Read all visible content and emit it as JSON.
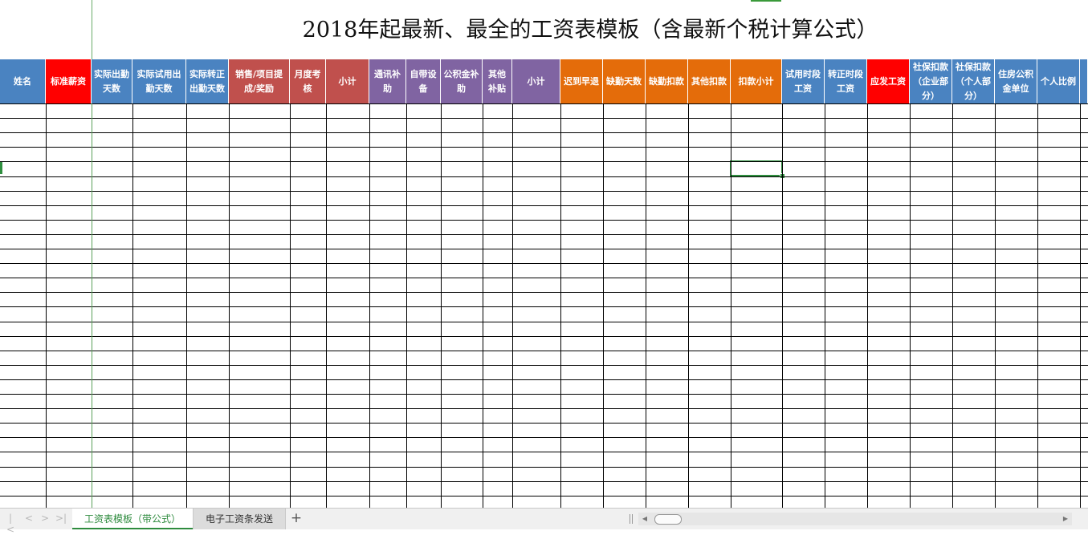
{
  "title": "2018年起最新、最全的工资表模板（含最新个税计算公式）",
  "headers": [
    {
      "label": "姓名",
      "color": "#4a83c1"
    },
    {
      "label": "标准薪资",
      "color": "#ff0000"
    },
    {
      "label": "实际出勤天数",
      "color": "#4a83c1"
    },
    {
      "label": "实际试用出勤天数",
      "color": "#4a83c1"
    },
    {
      "label": "实际转正出勤天数",
      "color": "#4a83c1"
    },
    {
      "label": "销售/项目提成/奖励",
      "color": "#c0504d"
    },
    {
      "label": "月度考核",
      "color": "#c0504d"
    },
    {
      "label": "小计",
      "color": "#c0504d"
    },
    {
      "label": "通讯补助",
      "color": "#8064a2"
    },
    {
      "label": "自带设备",
      "color": "#8064a2"
    },
    {
      "label": "公积金补助",
      "color": "#8064a2"
    },
    {
      "label": "其他补贴",
      "color": "#8064a2"
    },
    {
      "label": "小计",
      "color": "#8064a2"
    },
    {
      "label": "迟到早退",
      "color": "#e46c0a"
    },
    {
      "label": "缺勤天数",
      "color": "#e46c0a"
    },
    {
      "label": "缺勤扣款",
      "color": "#e46c0a"
    },
    {
      "label": "其他扣款",
      "color": "#e46c0a"
    },
    {
      "label": "扣款小计",
      "color": "#e46c0a"
    },
    {
      "label": "试用时段工资",
      "color": "#4a83c1"
    },
    {
      "label": "转正时段工资",
      "color": "#4a83c1"
    },
    {
      "label": "应发工资",
      "color": "#ff0000"
    },
    {
      "label": "社保扣款（企业部分）",
      "color": "#4a83c1"
    },
    {
      "label": "社保扣款（个人部分）",
      "color": "#4a83c1"
    },
    {
      "label": "住房公积金单位",
      "color": "#4a83c1"
    },
    {
      "label": "个人比例",
      "color": "#4a83c1"
    },
    {
      "label": "",
      "color": "#4a83c1"
    }
  ],
  "sheet_tabs": [
    {
      "label": "工资表模板（带公式）",
      "active": true
    },
    {
      "label": "电子工资条发送",
      "active": false
    }
  ],
  "add_sheet_glyph": "+",
  "nav_glyphs": [
    "|<",
    "<",
    ">",
    ">|"
  ],
  "scroll_glyphs": [
    "◀",
    "▶"
  ],
  "selected_cell": {
    "column": 18,
    "row": 5
  }
}
